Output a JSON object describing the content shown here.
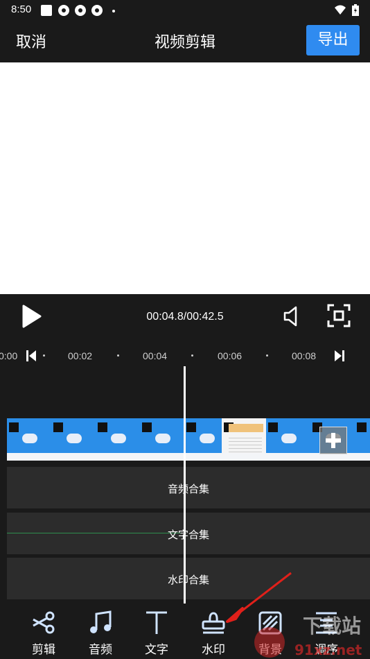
{
  "status_bar": {
    "time": "8:50"
  },
  "app_bar": {
    "cancel": "取消",
    "title": "视频剪辑",
    "export": "导出"
  },
  "playback": {
    "timecode": "00:04.8/00:42.5"
  },
  "ruler": {
    "ticks": [
      "0:00",
      "00:02",
      "00:04",
      "00:06",
      "00:08"
    ]
  },
  "tracks": {
    "audio": "音频合集",
    "text": "文字合集",
    "watermark": "水印合集"
  },
  "toolbar": {
    "items": [
      {
        "label": "剪辑",
        "icon": "scissors-icon"
      },
      {
        "label": "音频",
        "icon": "music-note-icon"
      },
      {
        "label": "文字",
        "icon": "text-t-icon"
      },
      {
        "label": "水印",
        "icon": "stamp-icon"
      },
      {
        "label": "背景",
        "icon": "background-icon"
      },
      {
        "label": "调序",
        "icon": "reorder-icon"
      }
    ]
  },
  "overlay_watermark": {
    "text_top": "下载站",
    "text_bottom": "91xz.net"
  },
  "colors": {
    "accent": "#2f8bf0",
    "background": "#1a1a1a",
    "track": "#2c2c2c",
    "arrow": "#e0201a"
  }
}
